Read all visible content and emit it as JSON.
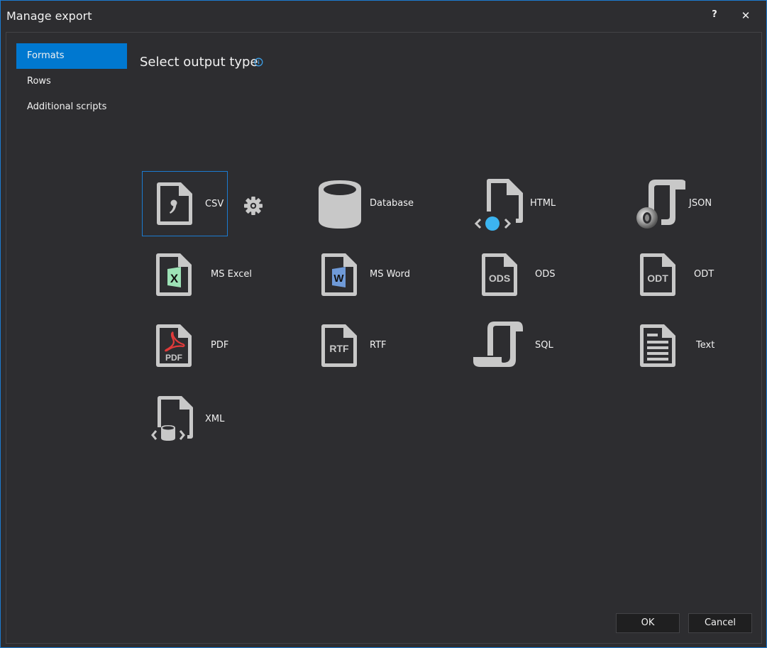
{
  "window": {
    "title": "Manage export",
    "help_label": "?",
    "close_label": "✕"
  },
  "nav": {
    "items": [
      {
        "label": "Formats",
        "active": true
      },
      {
        "label": "Rows",
        "active": false
      },
      {
        "label": "Additional scripts",
        "active": false
      }
    ]
  },
  "main": {
    "heading": "Select output type",
    "info_icon": "info-icon",
    "selected_format": "CSV",
    "formats": [
      {
        "label": "CSV",
        "icon": "csv-file-icon"
      },
      {
        "label": "Database",
        "icon": "database-icon"
      },
      {
        "label": "HTML",
        "icon": "html-file-icon"
      },
      {
        "label": "JSON",
        "icon": "json-scroll-icon"
      },
      {
        "label": "MS Excel",
        "icon": "excel-file-icon"
      },
      {
        "label": "MS Word",
        "icon": "word-file-icon"
      },
      {
        "label": "ODS",
        "icon": "ods-file-icon"
      },
      {
        "label": "ODT",
        "icon": "odt-file-icon"
      },
      {
        "label": "PDF",
        "icon": "pdf-file-icon"
      },
      {
        "label": "RTF",
        "icon": "rtf-file-icon"
      },
      {
        "label": "SQL",
        "icon": "sql-scroll-icon"
      },
      {
        "label": "Text",
        "icon": "text-file-icon"
      },
      {
        "label": "XML",
        "icon": "xml-file-icon"
      }
    ],
    "settings_icon": "gear-icon"
  },
  "icon_text": {
    "excel": "X",
    "word": "W",
    "ods": "ODS",
    "odt": "ODT",
    "pdf": "PDF",
    "rtf": "RTF"
  },
  "colors": {
    "accent": "#0078d0",
    "window_border": "#1c7bd1",
    "background": "#2d2d30",
    "icon_gray": "#c8c8c8",
    "html_dot": "#3cb4f0",
    "excel_green": "#9de2b6",
    "word_blue": "#6f9ad8",
    "pdf_red": "#e03a3a"
  },
  "footer": {
    "ok_label": "OK",
    "cancel_label": "Cancel"
  }
}
